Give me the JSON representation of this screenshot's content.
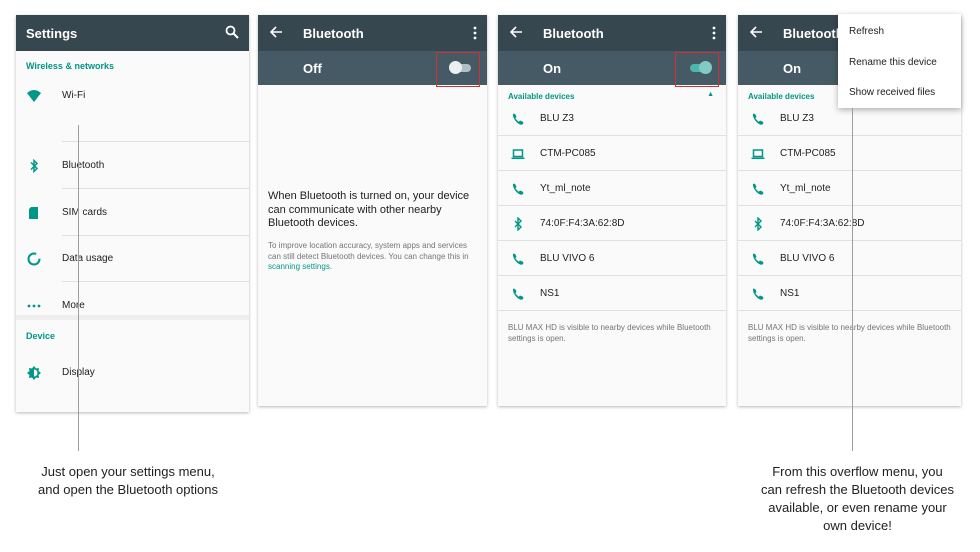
{
  "screen1": {
    "title": "Settings",
    "section_wireless": "Wireless & networks",
    "items": [
      {
        "label": "Wi-Fi",
        "icon": "wifi-icon"
      },
      {
        "label": "Bluetooth",
        "icon": "bluetooth-icon"
      },
      {
        "label": "SIM cards",
        "icon": "sim-card-icon"
      },
      {
        "label": "Data usage",
        "icon": "data-usage-icon"
      },
      {
        "label": "More",
        "icon": "more-dots-icon"
      }
    ],
    "section_device": "Device",
    "device_items": [
      {
        "label": "Display",
        "icon": "display-brightness-icon"
      }
    ]
  },
  "screen2": {
    "title": "Bluetooth",
    "toggle_label": "Off",
    "message": "When Bluetooth is turned on, your device can communicate with other nearby Bluetooth devices.",
    "note_prefix": "To improve location accuracy, system apps and services can still detect Bluetooth devices. You can change this in ",
    "note_link": "scanning settings",
    "note_suffix": "."
  },
  "screen3": {
    "title": "Bluetooth",
    "toggle_label": "On",
    "available_header": "Available devices",
    "devices": [
      {
        "name": "BLU Z3",
        "icon": "phone-icon"
      },
      {
        "name": "CTM-PC085",
        "icon": "laptop-icon"
      },
      {
        "name": "Yt_ml_note",
        "icon": "phone-icon"
      },
      {
        "name": "74:0F:F4:3A:62:8D",
        "icon": "bluetooth-icon"
      },
      {
        "name": "BLU VIVO 6",
        "icon": "phone-icon"
      },
      {
        "name": "NS1",
        "icon": "phone-icon"
      }
    ],
    "visibility_note": "BLU MAX HD  is visible to nearby devices while Bluetooth settings is open."
  },
  "screen4": {
    "title": "Bluetooth",
    "toggle_label": "On",
    "available_header": "Available devices",
    "devices": [
      {
        "name": "BLU Z3",
        "icon": "phone-icon"
      },
      {
        "name": "CTM-PC085",
        "icon": "laptop-icon"
      },
      {
        "name": "Yt_ml_note",
        "icon": "phone-icon"
      },
      {
        "name": "74:0F:F4:3A:62:8D",
        "icon": "bluetooth-icon"
      },
      {
        "name": "BLU VIVO 6",
        "icon": "phone-icon"
      },
      {
        "name": "NS1",
        "icon": "phone-icon"
      }
    ],
    "visibility_note": "BLU MAX HD  is visible to nearby devices while Bluetooth settings is open.",
    "menu": [
      "Refresh",
      "Rename this device",
      "Show received files"
    ]
  },
  "captions": {
    "left": "Just open your settings menu, and open the Bluetooth options",
    "right": "From this overflow menu, you can refresh the Bluetooth devices available, or even rename your own device!"
  },
  "colors": {
    "appbar": "#37474f",
    "switchbar": "#455a64",
    "accent": "#009688",
    "highlight_box": "#d32f2f"
  }
}
